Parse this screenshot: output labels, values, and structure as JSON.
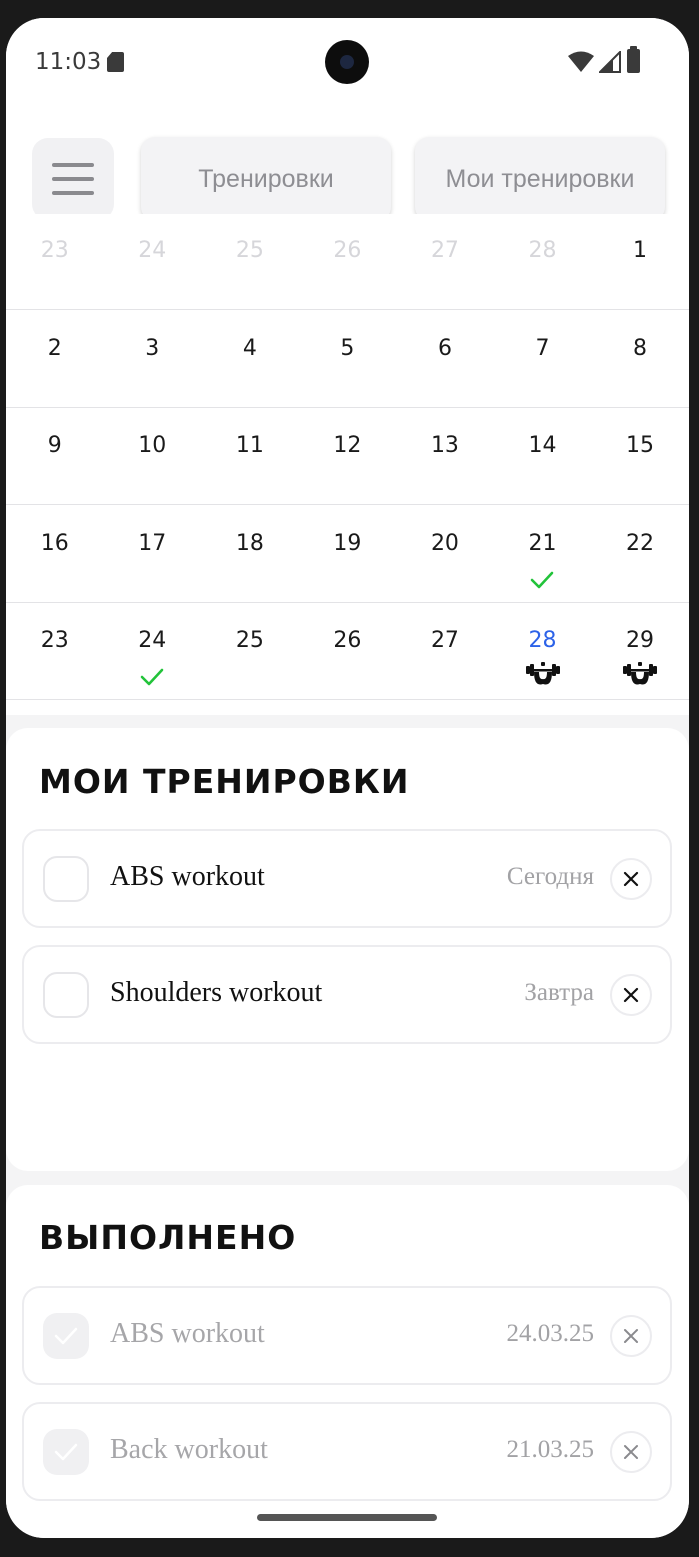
{
  "status_bar": {
    "time": "11:03"
  },
  "header": {
    "menu_icon": "hamburger-icon",
    "tabs": [
      {
        "label": "Тренировки"
      },
      {
        "label": "Мои тренировки"
      }
    ]
  },
  "calendar": {
    "weeks": [
      [
        {
          "day": "23",
          "muted": true
        },
        {
          "day": "24",
          "muted": true
        },
        {
          "day": "25",
          "muted": true
        },
        {
          "day": "26",
          "muted": true
        },
        {
          "day": "27",
          "muted": true
        },
        {
          "day": "28",
          "muted": true
        },
        {
          "day": "1"
        }
      ],
      [
        {
          "day": "2"
        },
        {
          "day": "3"
        },
        {
          "day": "4"
        },
        {
          "day": "5"
        },
        {
          "day": "6"
        },
        {
          "day": "7"
        },
        {
          "day": "8"
        }
      ],
      [
        {
          "day": "9"
        },
        {
          "day": "10"
        },
        {
          "day": "11"
        },
        {
          "day": "12"
        },
        {
          "day": "13"
        },
        {
          "day": "14"
        },
        {
          "day": "15"
        }
      ],
      [
        {
          "day": "16"
        },
        {
          "day": "17"
        },
        {
          "day": "18"
        },
        {
          "day": "19"
        },
        {
          "day": "20"
        },
        {
          "day": "21",
          "mark": "check-icon"
        },
        {
          "day": "22"
        }
      ],
      [
        {
          "day": "23"
        },
        {
          "day": "24",
          "mark": "check-icon"
        },
        {
          "day": "25"
        },
        {
          "day": "26"
        },
        {
          "day": "27"
        },
        {
          "day": "28",
          "today": true,
          "mark": "dumbbell-icon"
        },
        {
          "day": "29",
          "mark": "dumbbell-icon"
        }
      ]
    ],
    "today_color": "#2c62e8",
    "check_color": "#22c33a"
  },
  "my_workouts": {
    "title": "МОИ ТРЕНИРОВКИ",
    "items": [
      {
        "name": "ABS workout",
        "when": "Сегодня"
      },
      {
        "name": "Shoulders workout",
        "when": "Завтра"
      }
    ]
  },
  "completed": {
    "title": "ВЫПОЛНЕНО",
    "items": [
      {
        "name": "ABS workout",
        "date": "24.03.25"
      },
      {
        "name": "Back workout",
        "date": "21.03.25"
      }
    ]
  }
}
